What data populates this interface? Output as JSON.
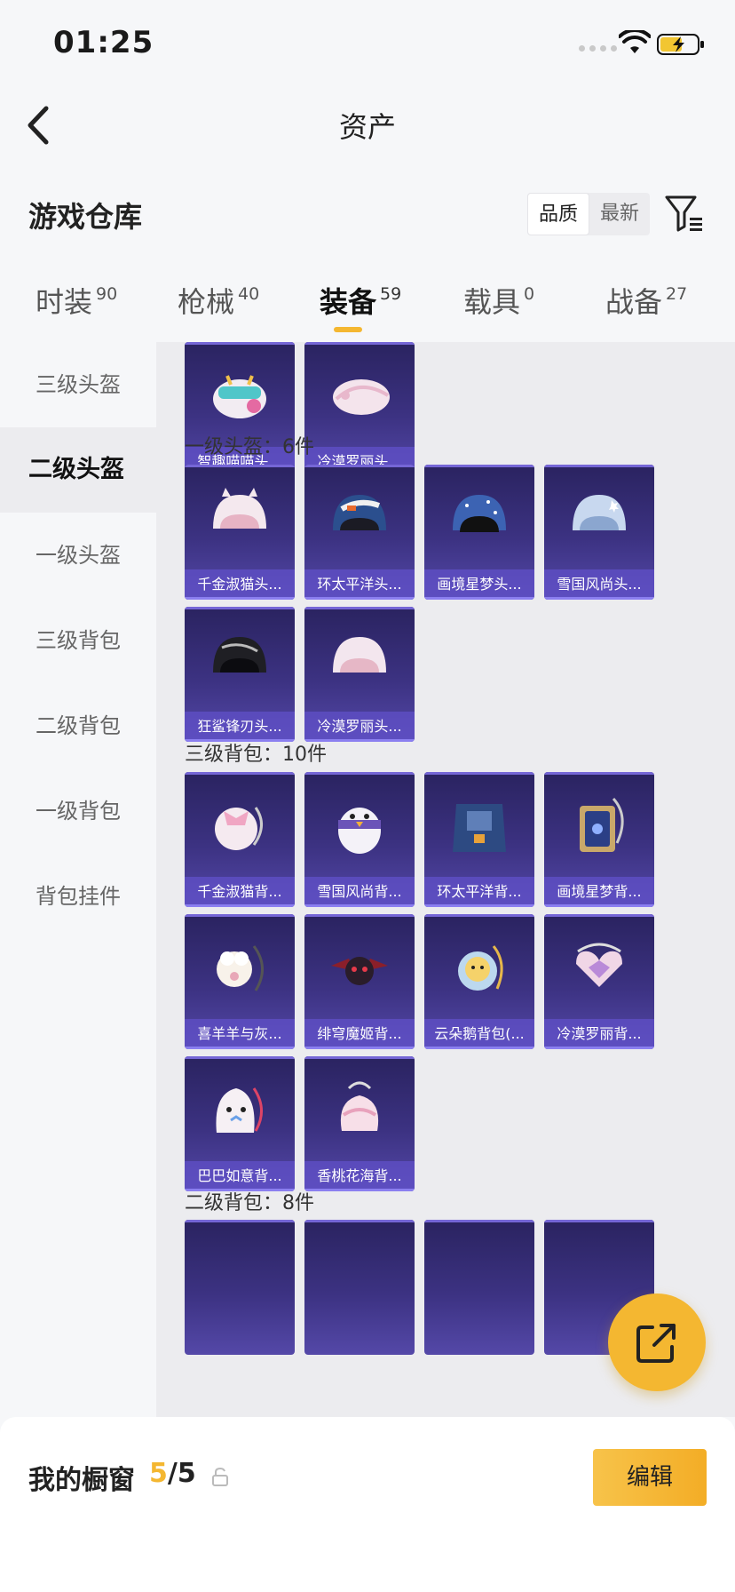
{
  "status_bar": {
    "time": "01:25"
  },
  "nav": {
    "title": "资产"
  },
  "header": {
    "title": "游戏仓库",
    "sort_options": [
      "品质",
      "最新"
    ]
  },
  "tabs": [
    {
      "label": "时装",
      "count": "90"
    },
    {
      "label": "枪械",
      "count": "40"
    },
    {
      "label": "装备",
      "count": "59"
    },
    {
      "label": "载具",
      "count": "0"
    },
    {
      "label": "战备",
      "count": "27"
    }
  ],
  "sidebar": {
    "items": [
      "三级头盔",
      "二级头盔",
      "一级头盔",
      "三级背包",
      "二级背包",
      "一级背包",
      "背包挂件"
    ],
    "active_index": 1
  },
  "sections": {
    "top_items": [
      "智趣喵喵头...",
      "冷漠罗丽头..."
    ],
    "level1_helmet": {
      "title": "一级头盔：6件",
      "items": [
        "千金淑猫头...",
        "环太平洋头...",
        "画境星梦头...",
        "雪国风尚头...",
        "狂鲨锋刃头...",
        "冷漠罗丽头..."
      ]
    },
    "level3_backpack": {
      "title": "三级背包：10件",
      "items": [
        "千金淑猫背...",
        "雪国风尚背...",
        "环太平洋背...",
        "画境星梦背...",
        "喜羊羊与灰...",
        "绯穹魔姬背...",
        "云朵鹅背包(...",
        "冷漠罗丽背...",
        "巴巴如意背...",
        "香桃花海背..."
      ]
    },
    "level2_backpack": {
      "title": "二级背包：8件"
    }
  },
  "bottom": {
    "showcase_label": "我的橱窗",
    "showcase_current": "5",
    "showcase_total": "/5",
    "edit_label": "编辑"
  },
  "colors": {
    "accent": "#f4b731",
    "card_bg": "#3c3282",
    "card_label": "#6050c8"
  }
}
